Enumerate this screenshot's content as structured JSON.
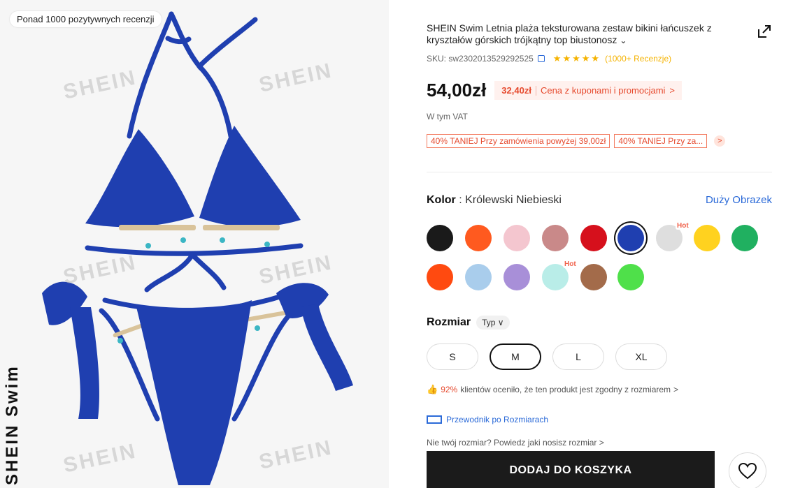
{
  "image_panel": {
    "review_badge": "Ponad 1000 pozytywnych recenzji",
    "watermark": "SHEIN",
    "brand_vertical": "SHEIN Swim",
    "bikini_color": "#1f3fb0"
  },
  "product": {
    "title": "SHEIN Swim Letnia plaża teksturowana zestaw bikini łańcuszek z kryształów górskich trójkątny top biustonosz",
    "sku": "SKU: sw2302013529292525",
    "reviews": "(1000+ Recenzje)",
    "price": "54,00zł",
    "coupon_price": "32,40zł",
    "coupon_text": "Cena z kuponami i promocjami",
    "coupon_arrow": ">",
    "vat": "W tym VAT",
    "promos": [
      "40% TANIEJ Przy zamówienia powyżej 39,00zł",
      "40% TANIEJ Przy za..."
    ],
    "promo_arrow": ">"
  },
  "color": {
    "label": "Kolor",
    "value": ": Królewski Niebieski",
    "big_image_link": "Duży Obrazek",
    "hot_label": "Hot",
    "swatches": [
      {
        "name": "black",
        "hex": "#1a1a1a"
      },
      {
        "name": "orange",
        "hex": "#ff5a1f"
      },
      {
        "name": "light-pink",
        "hex": "#f4c6cf"
      },
      {
        "name": "dusty-rose",
        "hex": "#c98989"
      },
      {
        "name": "red",
        "hex": "#d6101c"
      },
      {
        "name": "royal-blue",
        "hex": "#1f3fb0"
      },
      {
        "name": "light-grey",
        "hex": "#dedede"
      },
      {
        "name": "yellow",
        "hex": "#ffd21f"
      },
      {
        "name": "green",
        "hex": "#20b060"
      },
      {
        "name": "orange-red",
        "hex": "#ff4a10"
      },
      {
        "name": "light-blue",
        "hex": "#a9cdec"
      },
      {
        "name": "lavender",
        "hex": "#a88fd8"
      },
      {
        "name": "mint",
        "hex": "#b9ede8"
      },
      {
        "name": "brown",
        "hex": "#a36b4a"
      },
      {
        "name": "lime",
        "hex": "#4fe04a"
      }
    ]
  },
  "size": {
    "label": "Rozmiar",
    "type_pill": "Typ ∨",
    "options": [
      "S",
      "M",
      "L",
      "XL"
    ],
    "fit_pct": "92%",
    "fit_text": "klientów oceniło, że ten produkt jest zgodny z rozmiarem",
    "fit_arrow": ">",
    "guide": "Przewodnik po Rozmiarach",
    "not_your_size": "Nie twój rozmiar? Powiedz jaki nosisz rozmiar  >"
  },
  "actions": {
    "add_to_cart": "DODAJ DO KOSZYKA"
  }
}
